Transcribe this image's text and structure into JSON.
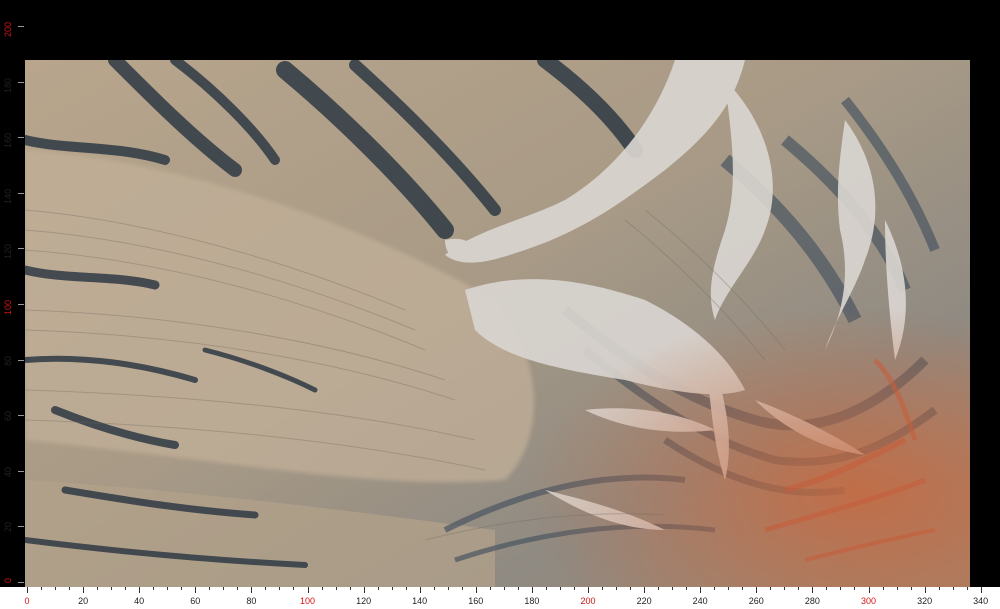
{
  "image": {
    "subject": "",
    "colors": {
      "background": "#000000",
      "ruler_background": "#ffffff",
      "ruler_major_label": "#d21414",
      "ruler_minor_label": "#222222",
      "slab_base": "#b9a58c",
      "vein_white": "#d8d4cf",
      "vein_dark": "#3b4650",
      "rust": "#c2673f"
    }
  },
  "ruler": {
    "y_labels": [
      {
        "text": "200",
        "major": true,
        "value": 200
      },
      {
        "text": "180",
        "major": false,
        "value": 180
      },
      {
        "text": "160",
        "major": false,
        "value": 160
      },
      {
        "text": "140",
        "major": false,
        "value": 140
      },
      {
        "text": "120",
        "major": false,
        "value": 120
      },
      {
        "text": "100",
        "major": true,
        "value": 100
      },
      {
        "text": "80",
        "major": false,
        "value": 80
      },
      {
        "text": "60",
        "major": false,
        "value": 60
      },
      {
        "text": "40",
        "major": false,
        "value": 40
      },
      {
        "text": "20",
        "major": false,
        "value": 20
      },
      {
        "text": "0",
        "major": true,
        "value": 0
      }
    ],
    "x_labels": [
      {
        "text": "0",
        "major": true,
        "value": 0
      },
      {
        "text": "20",
        "major": false,
        "value": 20
      },
      {
        "text": "40",
        "major": false,
        "value": 40
      },
      {
        "text": "60",
        "major": false,
        "value": 60
      },
      {
        "text": "80",
        "major": false,
        "value": 80
      },
      {
        "text": "100",
        "major": true,
        "value": 100
      },
      {
        "text": "120",
        "major": false,
        "value": 120
      },
      {
        "text": "140",
        "major": false,
        "value": 140
      },
      {
        "text": "160",
        "major": false,
        "value": 160
      },
      {
        "text": "180",
        "major": false,
        "value": 180
      },
      {
        "text": "200",
        "major": true,
        "value": 200
      },
      {
        "text": "220",
        "major": false,
        "value": 220
      },
      {
        "text": "240",
        "major": false,
        "value": 240
      },
      {
        "text": "260",
        "major": false,
        "value": 260
      },
      {
        "text": "280",
        "major": false,
        "value": 280
      },
      {
        "text": "300",
        "major": true,
        "value": 300
      },
      {
        "text": "320",
        "major": false,
        "value": 320
      },
      {
        "text": "340",
        "major": false,
        "value": 340
      }
    ]
  }
}
